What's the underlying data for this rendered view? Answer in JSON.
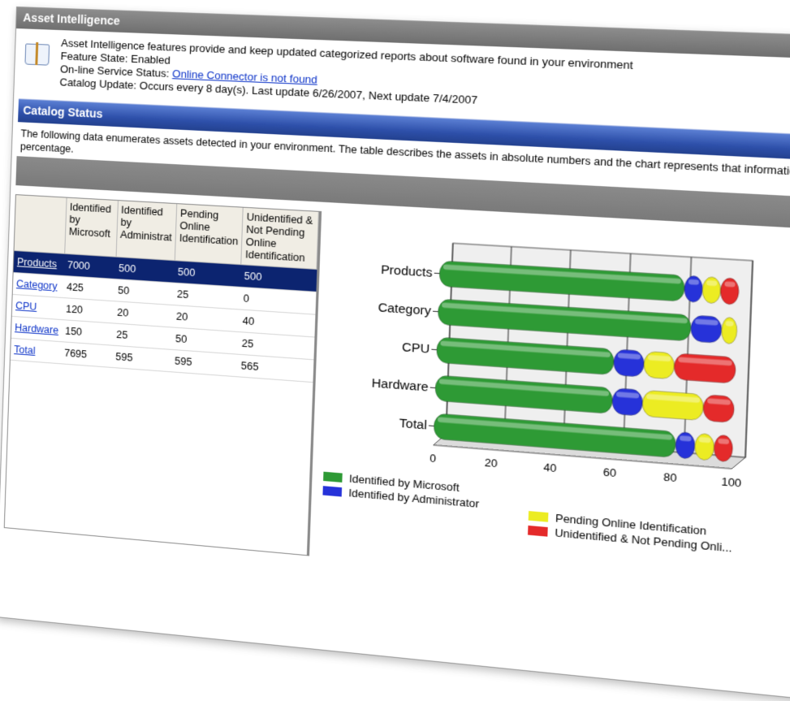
{
  "section_title": "Asset Intelligence",
  "info": {
    "description": "Asset Intelligence features provide and keep updated categorized reports about software found in your environment",
    "feature_state": "Feature State: Enabled",
    "online_status_label": "On-line Service Status:",
    "online_status_link": "Online Connector is not found",
    "catalog_update": "Catalog Update: Occurs every 8 day(s). Last update 6/26/2007, Next update 7/4/2007"
  },
  "catalog_status_title": "Catalog Status",
  "catalog_description": "The following data enumerates assets detected in your environment. The table describes the assets in absolute numbers and the chart represents that information in percentage.",
  "table": {
    "headers": [
      "",
      "Identified by Microsoft",
      "Identified by Administrat",
      "Pending Online Identification",
      "Unidentified & Not Pending Online Identification"
    ],
    "rows": [
      {
        "label": "Products",
        "values": [
          "7000",
          "500",
          "500",
          "500"
        ],
        "selected": true
      },
      {
        "label": "Category",
        "values": [
          "425",
          "50",
          "25",
          "0"
        ],
        "selected": false
      },
      {
        "label": "CPU",
        "values": [
          "120",
          "20",
          "20",
          "40"
        ],
        "selected": false
      },
      {
        "label": "Hardware",
        "values": [
          "150",
          "25",
          "50",
          "25"
        ],
        "selected": false
      },
      {
        "label": "Total",
        "values": [
          "7695",
          "595",
          "595",
          "565"
        ],
        "selected": false
      }
    ]
  },
  "chart_data": {
    "type": "bar",
    "orientation": "horizontal",
    "stacked": true,
    "percent": true,
    "categories": [
      "Products",
      "Category",
      "CPU",
      "Hardware",
      "Total"
    ],
    "series": [
      {
        "name": "Identified by Microsoft",
        "color": "#2e9a35",
        "values": [
          82.4,
          85.0,
          60.0,
          60.0,
          81.4
        ]
      },
      {
        "name": "Identified by Administrator",
        "color": "#2632d9",
        "values": [
          5.9,
          10.0,
          10.0,
          10.0,
          6.3
        ]
      },
      {
        "name": "Pending Online Identification",
        "color": "#ecec22",
        "values": [
          5.9,
          5.0,
          10.0,
          20.0,
          6.3
        ]
      },
      {
        "name": "Unidentified & Not Pending Onli...",
        "color": "#e42a2a",
        "values": [
          5.9,
          0.0,
          20.0,
          10.0,
          6.0
        ]
      }
    ],
    "xlim": [
      0,
      100
    ],
    "xticks": [
      "0",
      "20",
      "40",
      "60",
      "80",
      "100"
    ],
    "grid": true,
    "legend_position": "bottom"
  }
}
